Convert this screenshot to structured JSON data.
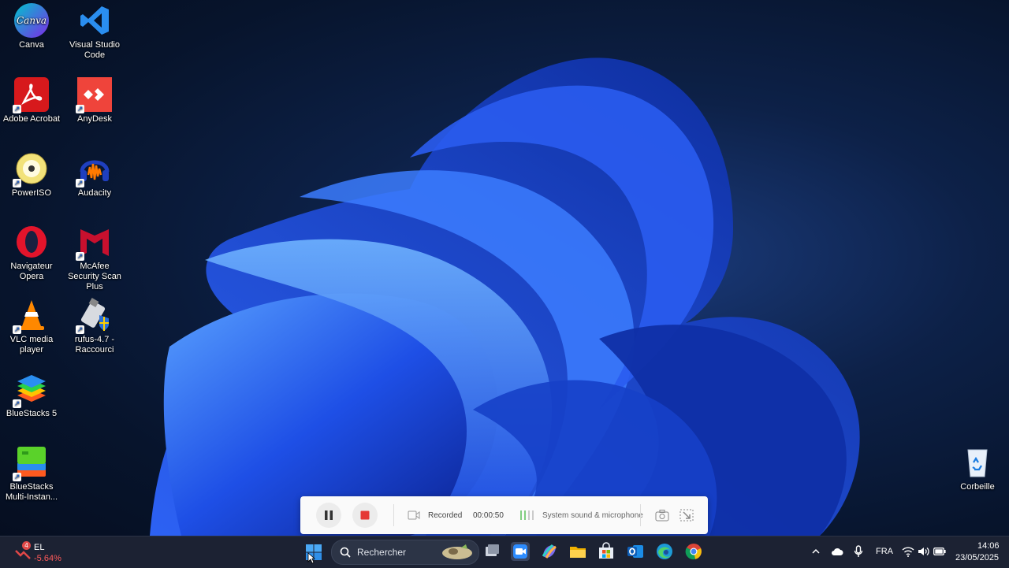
{
  "desktop": {
    "icons": [
      {
        "label": "Canva",
        "icon": "canva-icon"
      },
      {
        "label": "Visual Studio Code",
        "icon": "vscode-icon"
      },
      {
        "label": "Adobe Acrobat",
        "icon": "acrobat-icon"
      },
      {
        "label": "AnyDesk",
        "icon": "anydesk-icon"
      },
      {
        "label": "PowerISO",
        "icon": "poweriso-icon"
      },
      {
        "label": "Audacity",
        "icon": "audacity-icon"
      },
      {
        "label": "Navigateur Opera",
        "icon": "opera-icon"
      },
      {
        "label": "McAfee Security Scan Plus",
        "icon": "mcafee-icon"
      },
      {
        "label": "VLC media player",
        "icon": "vlc-icon"
      },
      {
        "label": "rufus-4.7 - Raccourci",
        "icon": "rufus-icon"
      },
      {
        "label": "BlueStacks 5",
        "icon": "bluestacks-icon"
      },
      {
        "label": "BlueStacks Multi-Instan...",
        "icon": "bluestacks-multi-icon"
      },
      {
        "label": "Corbeille",
        "icon": "recycle-bin-icon"
      }
    ],
    "icon_letters": {
      "canva": "Canva"
    }
  },
  "recorder": {
    "status": "Recorded",
    "time": "00:00:50",
    "audio": "System sound & microphone"
  },
  "taskbar": {
    "widget": {
      "name": "EL",
      "change": "-5.64%",
      "badge": "4"
    },
    "search_placeholder": "Rechercher",
    "language": "FRA",
    "time": "14:06",
    "date": "23/05/2025"
  },
  "colors": {
    "accent": "#1a5fd0",
    "stop": "#e53935",
    "taskbar": "#1c2233",
    "negative": "#ff5a5a"
  }
}
